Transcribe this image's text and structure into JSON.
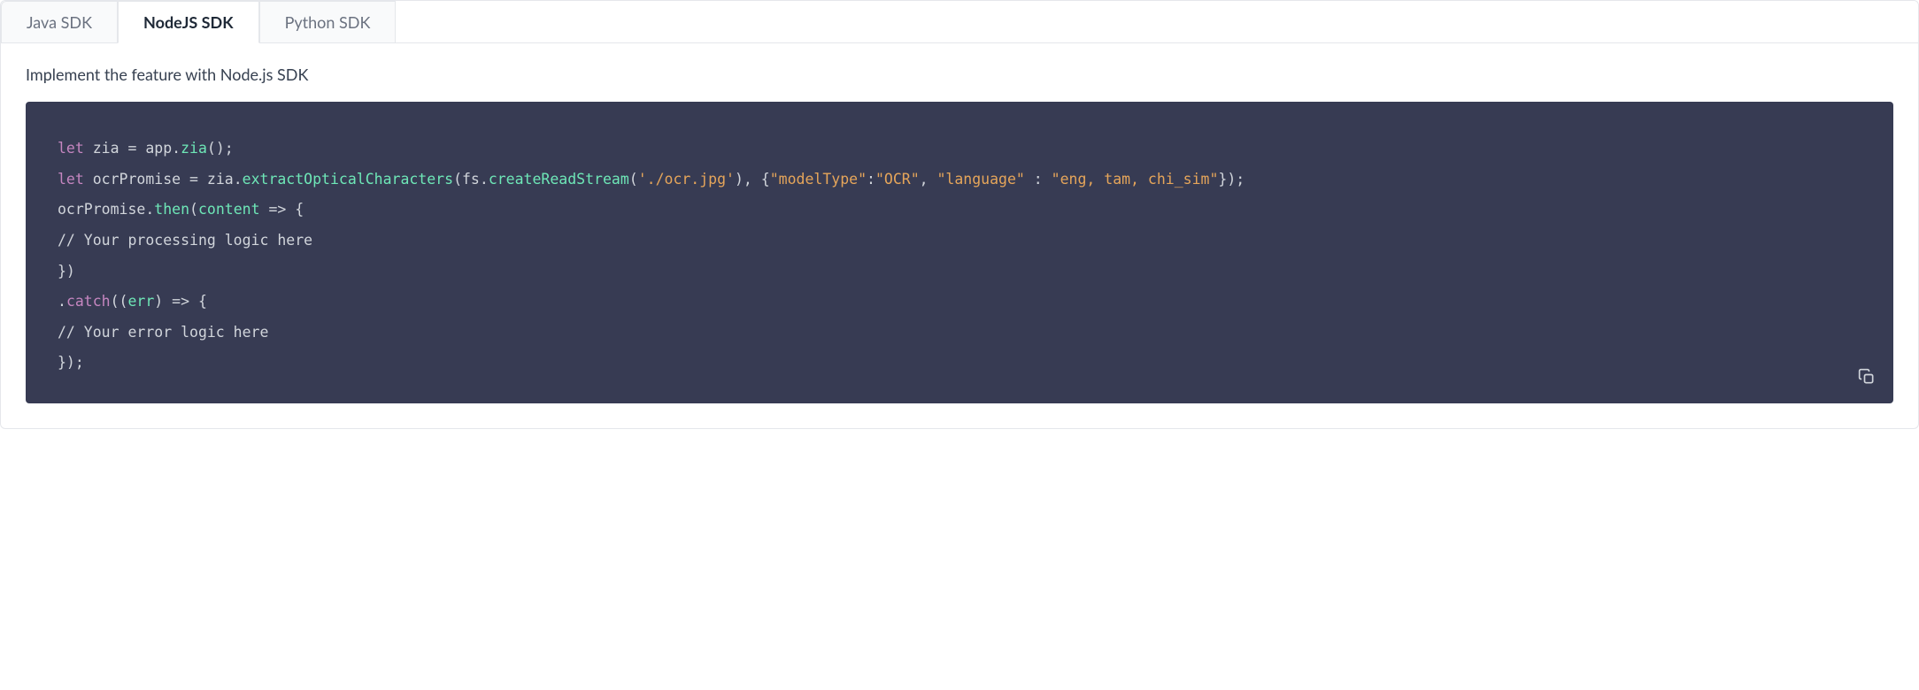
{
  "tabs": [
    {
      "label": "Java SDK",
      "active": false
    },
    {
      "label": "NodeJS SDK",
      "active": true
    },
    {
      "label": "Python SDK",
      "active": false
    }
  ],
  "description": "Implement the feature with Node.js SDK",
  "code": {
    "line1": {
      "kw": "let",
      "var": " zia ",
      "eq": "=",
      "sp": " app.",
      "fn": "zia",
      "end": "();"
    },
    "line2": {
      "kw": "let",
      "var": " ocrPromise ",
      "eq": "=",
      "sp": " zia.",
      "fn": "extractOpticalCharacters",
      "p1": "(fs.",
      "fn2": "createReadStream",
      "p2": "(",
      "str1": "'./ocr.jpg'",
      "p3": "), {",
      "str2": "\"modelType\"",
      "p4": ":",
      "str3": "\"OCR\"",
      "p5": ", ",
      "str4": "\"language\"",
      "p6": " : ",
      "str5": "\"eng, tam, chi_sim\"",
      "p7": "});"
    },
    "line3": {
      "var": "ocrPromise.",
      "fn": "then",
      "p1": "(",
      "param": "content",
      "arrow": " => {"
    },
    "line4": "// Your processing logic here",
    "line5": "})",
    "line6": {
      "dot": ".",
      "fn": "catch",
      "p1": "((",
      "param": "err",
      "p2": ") ",
      "arrow": "=> {"
    },
    "line7": "// Your error logic here",
    "line8": "});"
  },
  "copy_label": "Copy"
}
